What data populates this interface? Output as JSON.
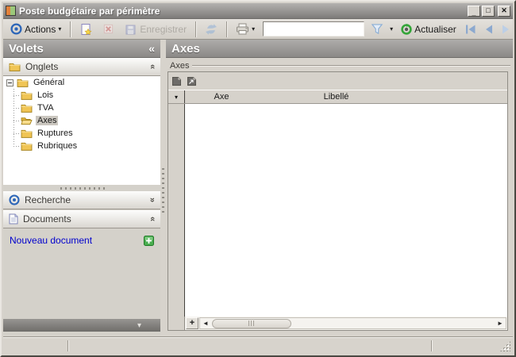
{
  "window": {
    "title": "Poste budgétaire par périmètre",
    "controls": {
      "minimize": "_",
      "maximize": "□",
      "close": "✕"
    }
  },
  "toolbar": {
    "actions_label": "Actions",
    "save_label": "Enregistrer",
    "actualiser_label": "Actualiser",
    "search_value": ""
  },
  "sidebar": {
    "title": "Volets",
    "sections": {
      "onglets": "Onglets",
      "recherche": "Recherche",
      "documents": "Documents"
    },
    "tree": {
      "root": "Général",
      "items": [
        "Lois",
        "TVA",
        "Axes",
        "Ruptures",
        "Rubriques"
      ],
      "selected": "Axes"
    },
    "new_document_label": "Nouveau document"
  },
  "main": {
    "title": "Axes",
    "groupbox_label": "Axes",
    "grid": {
      "columns": [
        "Axe",
        "Libellé"
      ],
      "rows": []
    }
  },
  "status": {
    "left": "",
    "center": "",
    "right": ""
  },
  "glyphs": {
    "collapse_left": "«",
    "chevron_double": "«",
    "dropdown": "▾",
    "footer_chevron": "▾",
    "grid_filter": "▾",
    "add_row": "+",
    "scroll_left": "◄",
    "scroll_right": "►"
  },
  "colors": {
    "titlebar_gray": "#8b8987",
    "toolbar_bg": "#d9d5cf",
    "header_gray": "#9a9896",
    "selection_gray": "#cbc7c0",
    "link_blue": "#0000cd",
    "folder_yellow": "#f0c555",
    "accent_blue": "#2d66b8",
    "refresh_green": "#35a53a",
    "plus_green": "#3fa044"
  }
}
